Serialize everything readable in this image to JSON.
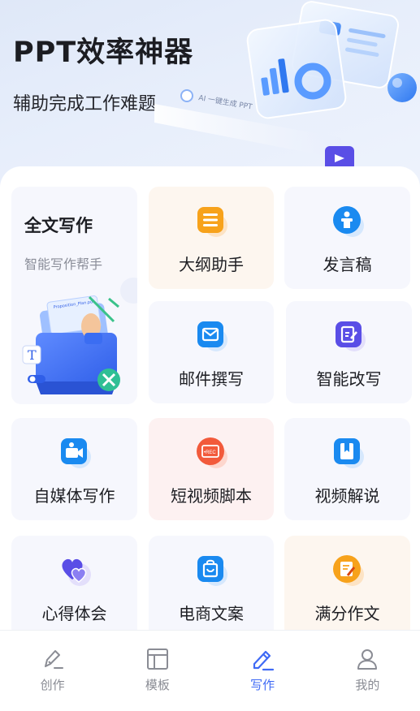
{
  "hero": {
    "title": "PPT效率神器",
    "subtitle": "辅助完成工作难题",
    "chip_text": "AI 一键生成 PPT"
  },
  "feature_card": {
    "title": "全文写作",
    "subtitle": "智能写作帮手",
    "illustration_badge_letter": "T",
    "illustration_file_label": "Proposition_Plan.pdf"
  },
  "tools": [
    {
      "label": "大纲助手",
      "icon": "outline-list-icon",
      "color": "#f7a21b"
    },
    {
      "label": "发言稿",
      "icon": "speaker-podium-icon",
      "color": "#1a8af0"
    },
    {
      "label": "邮件撰写",
      "icon": "mail-icon",
      "color": "#1a8af0"
    },
    {
      "label": "智能改写",
      "icon": "edit-document-icon",
      "color": "#5a4ee6"
    },
    {
      "label": "自媒体写作",
      "icon": "video-camera-icon",
      "color": "#1a8af0"
    },
    {
      "label": "短视频脚本",
      "icon": "rec-video-icon",
      "color": "#f25a3b",
      "rec_text": "•REC"
    },
    {
      "label": "视频解说",
      "icon": "bookmark-book-icon",
      "color": "#1a8af0"
    },
    {
      "label": "心得体会",
      "icon": "hearts-icon",
      "color": "#5a4ee6"
    },
    {
      "label": "电商文案",
      "icon": "shopping-bag-icon",
      "color": "#1a8af0"
    },
    {
      "label": "满分作文",
      "icon": "note-pen-icon",
      "color": "#f7a21b"
    }
  ],
  "tabbar": {
    "items": [
      {
        "label": "创作",
        "icon": "pen-create-icon",
        "active": false
      },
      {
        "label": "模板",
        "icon": "template-layout-icon",
        "active": false
      },
      {
        "label": "写作",
        "icon": "pencil-write-icon",
        "active": true
      },
      {
        "label": "我的",
        "icon": "user-profile-icon",
        "active": false
      }
    ]
  },
  "colors": {
    "accent": "#3f6af5",
    "inactive": "#8a8c94"
  }
}
